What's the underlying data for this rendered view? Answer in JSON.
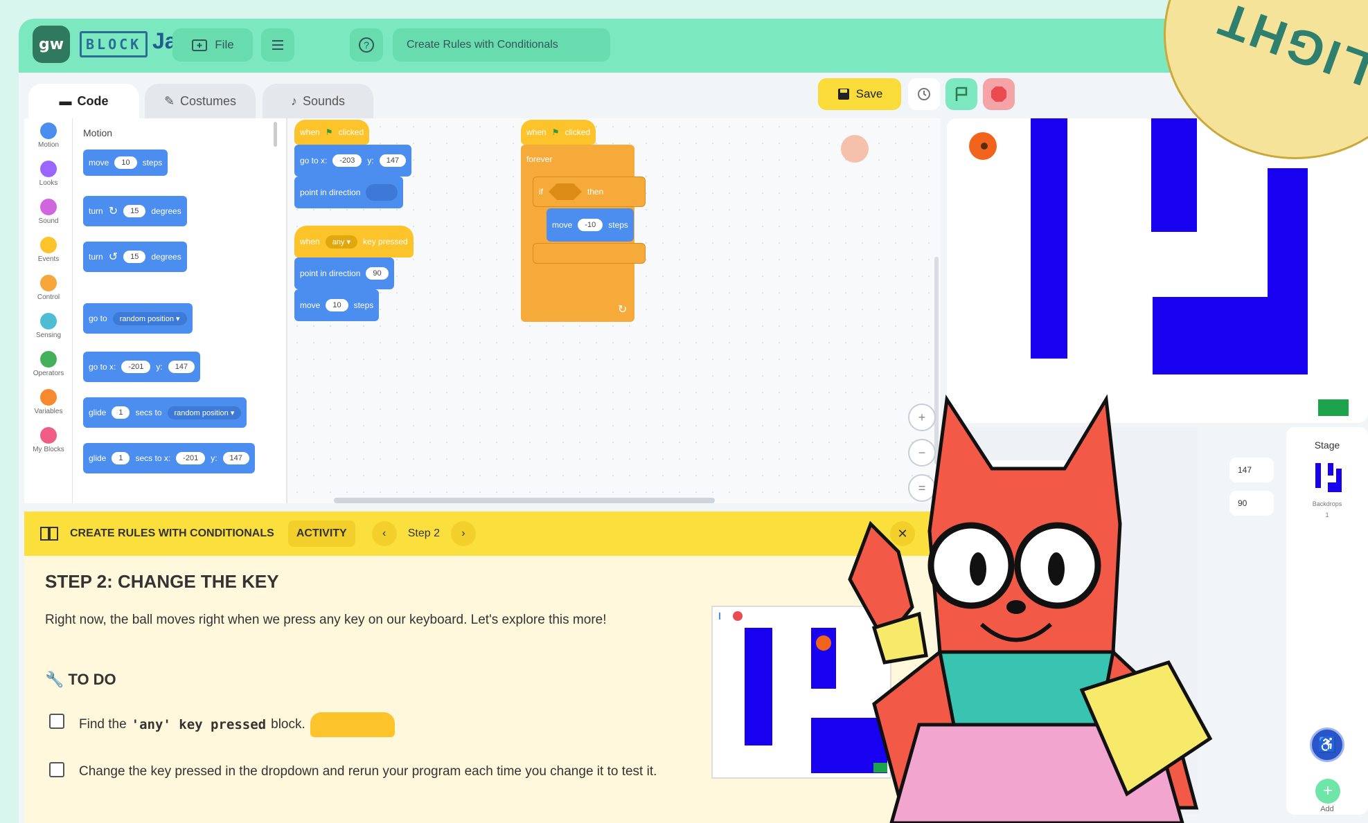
{
  "header": {
    "logo_block": "BLOCK",
    "logo_jam": "Jam",
    "file_label": "File",
    "project_title": "Create Rules with Conditionals",
    "save_label": "Save"
  },
  "tabs": [
    {
      "label": "Code",
      "icon": "code-icon"
    },
    {
      "label": "Costumes",
      "icon": "brush-icon"
    },
    {
      "label": "Sounds",
      "icon": "speaker-icon"
    }
  ],
  "categories": [
    {
      "label": "Motion",
      "color": "#4c8df0"
    },
    {
      "label": "Looks",
      "color": "#9a66ff"
    },
    {
      "label": "Sound",
      "color": "#d065de"
    },
    {
      "label": "Events",
      "color": "#fcc32a"
    },
    {
      "label": "Control",
      "color": "#f6a63a"
    },
    {
      "label": "Sensing",
      "color": "#4fbcd4"
    },
    {
      "label": "Operators",
      "color": "#45b05a"
    },
    {
      "label": "Variables",
      "color": "#f7892e"
    },
    {
      "label": "My Blocks",
      "color": "#f05d86"
    }
  ],
  "palette": {
    "header": "Motion",
    "move": {
      "a": "move",
      "n": "10",
      "b": "steps"
    },
    "turn_cw": {
      "a": "turn",
      "n": "15",
      "b": "degrees"
    },
    "turn_ccw": {
      "a": "turn",
      "n": "15",
      "b": "degrees"
    },
    "goto": {
      "a": "go to",
      "opt": "random position ▾"
    },
    "gotoxy": {
      "a": "go to x:",
      "x": "-201",
      "y_label": "y:",
      "y": "147"
    },
    "glide1": {
      "a": "glide",
      "n": "1",
      "b": "secs to",
      "opt": "random position ▾"
    },
    "glide2": {
      "a": "glide",
      "n": "1",
      "b": "secs to x:",
      "x": "-201",
      "y_label": "y:",
      "y": "147"
    }
  },
  "scripts": {
    "s1_hat": {
      "a": "when",
      "b": "clicked"
    },
    "s1_goto": {
      "a": "go to x:",
      "x": "-203",
      "y_label": "y:",
      "y": "147"
    },
    "s1_point": {
      "a": "point in direction"
    },
    "s2_hat": {
      "a": "when",
      "opt": "any ▾",
      "b": "key pressed"
    },
    "s2_point": {
      "a": "point in direction",
      "n": "90"
    },
    "s2_move": {
      "a": "move",
      "n": "10",
      "b": "steps"
    },
    "s3_hat": {
      "a": "when",
      "b": "clicked"
    },
    "s3_forever": "forever",
    "s3_if": {
      "a": "if",
      "b": "then"
    },
    "s3_move": {
      "a": "move",
      "n": "-10",
      "b": "steps"
    }
  },
  "sprite_info": {
    "y": "147",
    "direction": "90"
  },
  "stage_panel": {
    "title": "Stage",
    "backdrops_label": "Backdrops",
    "backdrops_count": "1",
    "add_label": "Add"
  },
  "tutorial": {
    "title": "CREATE RULES WITH CONDITIONALS",
    "activity_label": "ACTIVITY",
    "step_label": "Step 2",
    "step_heading": "STEP 2: CHANGE THE KEY",
    "body": "Right now, the ball moves right when we press any key on our keyboard. Let's explore this more!",
    "todo_label": "TO DO",
    "item1_pre": "Find the",
    "item1_code": "'any' key pressed",
    "item1_post": "block.",
    "item2": "Change the key pressed in the dropdown and rerun your program each time you change it to test it."
  },
  "seal_text": "LIGHT",
  "colors": {
    "topbar": "#7be8c0",
    "motion": "#4c8df0",
    "events": "#fcc32a",
    "control": "#f6aa3a",
    "maze": "#1800f0",
    "tutorial_bar": "#fbe03d"
  }
}
